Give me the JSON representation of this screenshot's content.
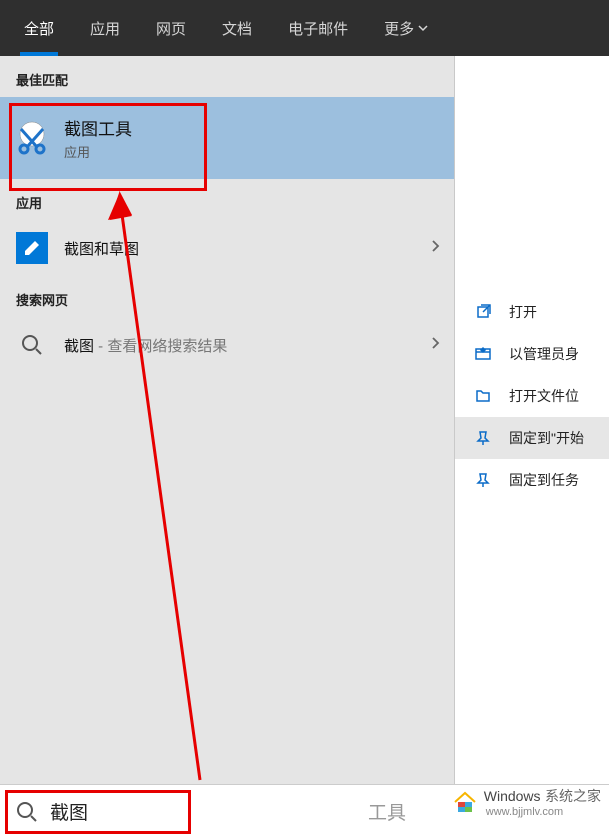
{
  "tabs": {
    "items": [
      "全部",
      "应用",
      "网页",
      "文档",
      "电子邮件",
      "更多"
    ],
    "active": 0
  },
  "sections": {
    "best_match": "最佳匹配",
    "apps": "应用",
    "web": "搜索网页"
  },
  "best": {
    "title": "截图工具",
    "subtitle": "应用"
  },
  "app_row": {
    "title": "截图和草图"
  },
  "web_row": {
    "title": "截图",
    "suffix": " - 查看网络搜索结果"
  },
  "actions": {
    "items": [
      {
        "icon": "open",
        "label": "打开",
        "sel": false
      },
      {
        "icon": "admin",
        "label": "以管理员身",
        "sel": false
      },
      {
        "icon": "folder",
        "label": "打开文件位",
        "sel": false
      },
      {
        "icon": "pin",
        "label": "固定到\"开始",
        "sel": true
      },
      {
        "icon": "pin",
        "label": "固定到任务",
        "sel": false
      }
    ]
  },
  "search": {
    "value": "截图",
    "placeholder_rest": "工具"
  },
  "watermark": {
    "line1": "Windows",
    "line2": "系统之家",
    "url": "www.bjjmlv.com"
  }
}
